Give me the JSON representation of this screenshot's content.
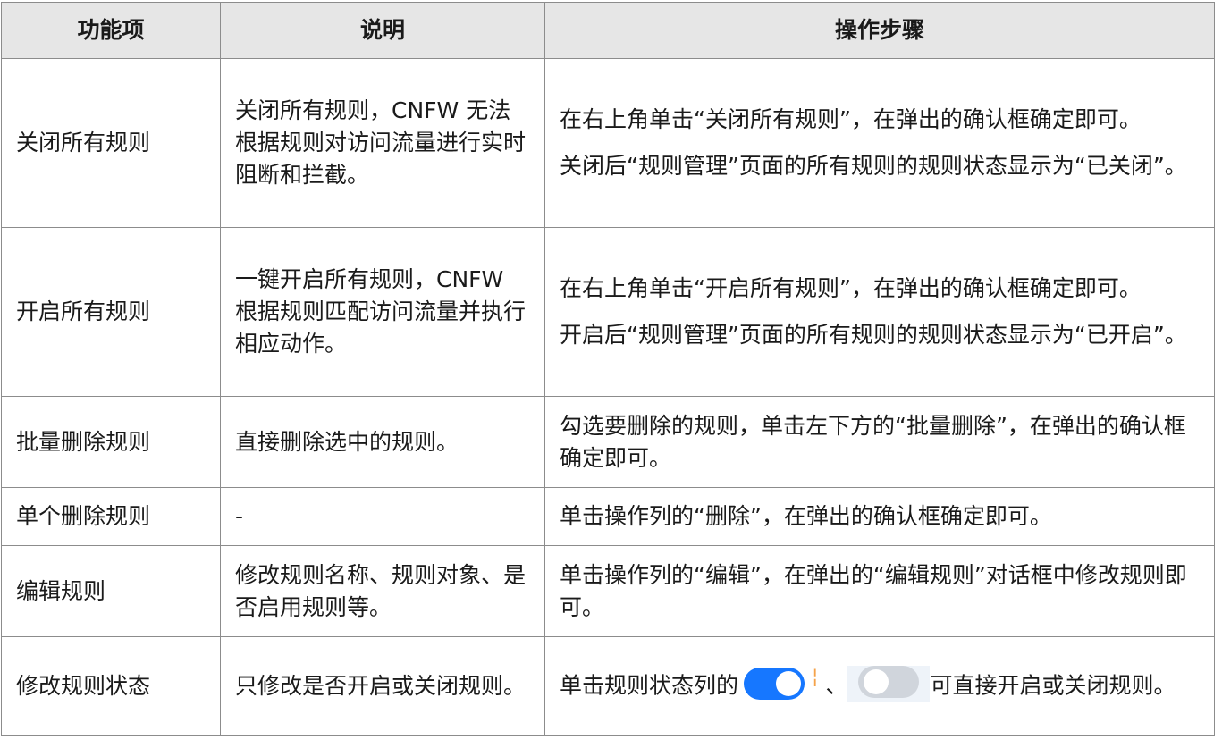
{
  "table": {
    "headers": [
      "功能项",
      "说明",
      "操作步骤"
    ],
    "rows": [
      {
        "name": "关闭所有规则",
        "desc": "关闭所有规则，CNFW 无法根据规则对访问流量进行实时阻断和拦截。",
        "steps": [
          "在右上角单击“关闭所有规则”，在弹出的确认框确定即可。",
          "关闭后“规则管理”页面的所有规则的规则状态显示为“已关闭”。"
        ]
      },
      {
        "name": "开启所有规则",
        "desc": "一键开启所有规则，CNFW 根据规则匹配访问流量并执行相应动作。",
        "steps": [
          "在右上角单击“开启所有规则”，在弹出的确认框确定即可。",
          "开启后“规则管理”页面的所有规则的规则状态显示为“已开启”。"
        ]
      },
      {
        "name": "批量删除规则",
        "desc": "直接删除选中的规则。",
        "steps": [
          "勾选要删除的规则，单击左下方的“批量删除”，在弹出的确认框确定即可。"
        ]
      },
      {
        "name": "单个删除规则",
        "desc": "-",
        "steps": [
          "单击操作列的“删除”，在弹出的确认框确定即可。"
        ]
      },
      {
        "name": "编辑规则",
        "desc": "修改规则名称、规则对象、是否启用规则等。",
        "steps": [
          "单击操作列的“编辑”，在弹出的“编辑规则”对话框中修改规则即可。"
        ]
      },
      {
        "name": "修改规则状态",
        "desc": "只修改是否开启或关闭规则。",
        "steps_inline": {
          "before": "单击规则状态列的",
          "separator": "、",
          "after": "可直接开启或关闭规则。"
        }
      }
    ]
  },
  "colors": {
    "header_bg": "#e6e6e6",
    "border": "#8c8c8c",
    "toggle_on": "#1677ff",
    "toggle_off": "#d0d5dc"
  },
  "icons": {
    "toggle_on": "toggle-on-icon",
    "toggle_off": "toggle-off-icon"
  }
}
